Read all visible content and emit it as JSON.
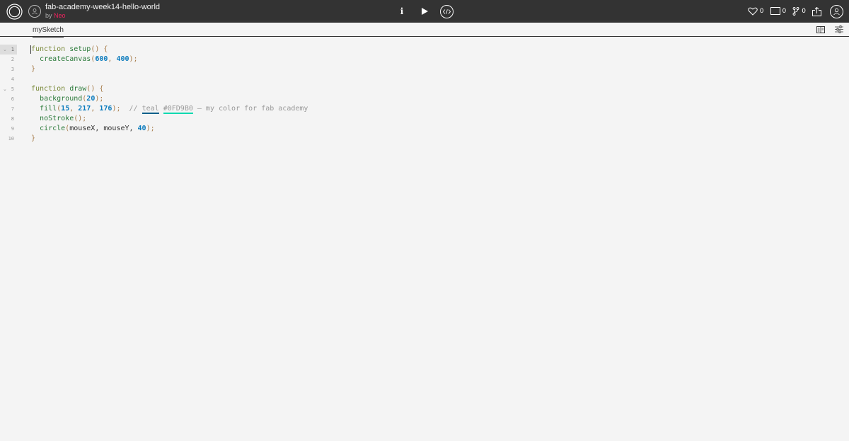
{
  "header": {
    "sketch_title": "fab-academy-week14-hello-world",
    "by_label": "by",
    "author": "Neo",
    "likes_count": "0",
    "comments_count": "0",
    "forks_count": "0"
  },
  "controls": {
    "info_label": "i"
  },
  "tabs": {
    "active_file": "mySketch"
  },
  "editor": {
    "lines": [
      {
        "num": "1"
      },
      {
        "num": "2"
      },
      {
        "num": "3"
      },
      {
        "num": "4"
      },
      {
        "num": "5"
      },
      {
        "num": "6"
      },
      {
        "num": "7"
      },
      {
        "num": "8"
      },
      {
        "num": "9"
      },
      {
        "num": "10"
      }
    ],
    "code": {
      "l1_kw": "function",
      "l1_name": "setup",
      "l2_fn": "createCanvas",
      "l2_a": "600",
      "l2_b": "400",
      "l5_kw": "function",
      "l5_name": "draw",
      "l6_fn": "background",
      "l6_a": "20",
      "l7_fn": "fill",
      "l7_a": "15",
      "l7_b": "217",
      "l7_c": "176",
      "l7_comment_prefix": "// ",
      "l7_word1": "teal",
      "l7_word2": "#0FD9B0",
      "l7_comment_rest": " — my color for fab academy",
      "l8_fn": "noStroke",
      "l9_fn": "circle",
      "l9_args": "mouseX, mouseY, ",
      "l9_a": "40"
    }
  },
  "colors": {
    "topbar_bg": "#333333",
    "author_accent": "#ed225d",
    "editor_bg": "#f4f4f4",
    "number": "#0b7bbd",
    "teal_swatch": "#0fd9b0"
  },
  "icons": [
    "p5-logo-icon",
    "user-avatar-icon",
    "play-icon",
    "embed-code-icon",
    "heart-icon",
    "comment-icon",
    "fork-icon",
    "share-icon",
    "user-profile-icon",
    "layout-icon",
    "settings-sliders-icon",
    "fold-arrow-icon"
  ]
}
